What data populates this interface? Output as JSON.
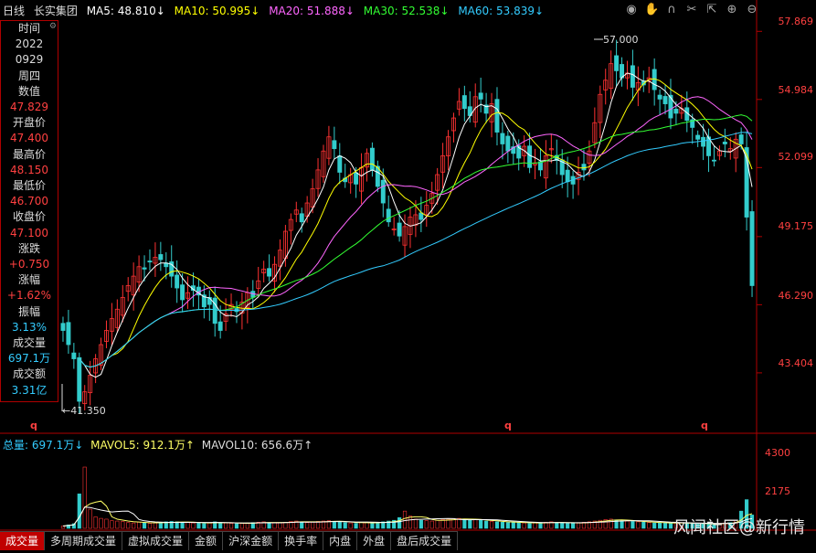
{
  "header": {
    "period": "日线",
    "stock": "长实集团",
    "ma5": "MA5: 48.810↓",
    "ma10": "MA10: 50.995↓",
    "ma20": "MA20: 51.888↓",
    "ma30": "MA30: 52.538↓",
    "ma60": "MA60: 53.839↓"
  },
  "toolbar_icons": [
    "eye-icon",
    "hand-icon",
    "magnet-icon",
    "scissors-icon",
    "cursor-icon",
    "zoom-in-icon",
    "zoom-out-icon"
  ],
  "info": {
    "time_label": "时间",
    "year": "2022",
    "date": "0929",
    "weekday": "周四",
    "value_label": "数值",
    "value": "47.829",
    "open_label": "开盘价",
    "open": "47.400",
    "high_label": "最高价",
    "high": "48.150",
    "low_label": "最低价",
    "low": "46.700",
    "close_label": "收盘价",
    "close": "47.100",
    "change_label": "涨跌",
    "change": "+0.750",
    "pct_label": "涨幅",
    "pct": "+1.62%",
    "amp_label": "振幅",
    "amp": "3.13%",
    "vol_label": "成交量",
    "vol": "697.1万",
    "amt_label": "成交额",
    "amt": "3.31亿"
  },
  "price_axis": [
    "57.869",
    "54.984",
    "52.099",
    "49.175",
    "46.290",
    "43.404"
  ],
  "annotations": {
    "high": "57.000",
    "low": "←41.350"
  },
  "q_marker": "q",
  "volume_header": {
    "total": "总量: 697.1万↓",
    "mavol5": "MAVOL5: 912.1万↑",
    "mavol10": "MAVOL10: 656.6万↑"
  },
  "volume_axis": [
    "4300",
    "2175"
  ],
  "tabs": [
    "成交量",
    "多周期成交量",
    "虚拟成交量",
    "金额",
    "沪深金额",
    "换手率",
    "内盘",
    "外盘",
    "盘后成交量"
  ],
  "active_tab": "成交量",
  "watermark": "风闻社区@新行情",
  "colors": {
    "up": "#ff3232",
    "down": "#33cccc",
    "ma5": "#ffffff",
    "ma10": "#ffff00",
    "ma20": "#ff66ff",
    "ma30": "#33ff33",
    "ma60": "#33ccff",
    "axis": "#b00000"
  },
  "chart_data": {
    "type": "candlestick",
    "y_range": [
      41.0,
      58.5
    ],
    "close_series": [
      45.2,
      44.6,
      44.0,
      42.2,
      42.6,
      43.3,
      44.0,
      44.6,
      45.2,
      45.7,
      46.1,
      46.6,
      47.1,
      47.5,
      47.9,
      47.8,
      48.1,
      48.3,
      48.2,
      47.9,
      47.5,
      47.0,
      46.5,
      46.8,
      46.9,
      46.7,
      46.2,
      46.3,
      45.5,
      45.2,
      45.9,
      46.3,
      46.0,
      46.4,
      46.8,
      46.6,
      47.3,
      47.8,
      47.5,
      48.0,
      48.6,
      49.4,
      49.9,
      50.3,
      49.8,
      50.6,
      51.2,
      52.0,
      52.8,
      53.4,
      52.9,
      51.9,
      51.5,
      51.8,
      51.4,
      52.1,
      52.7,
      52.0,
      51.3,
      50.6,
      49.8,
      49.5,
      49.2,
      49.6,
      50.0,
      50.1,
      49.9,
      50.5,
      51.0,
      51.8,
      52.6,
      53.4,
      54.2,
      54.9,
      54.6,
      54.3,
      55.1,
      55.0,
      54.4,
      54.8,
      53.6,
      53.1,
      52.8,
      52.7,
      52.5,
      53.0,
      52.1,
      52.3,
      52.0,
      52.6,
      52.9,
      52.4,
      51.8,
      51.5,
      51.4,
      51.9,
      52.0,
      52.8,
      54.0,
      55.2,
      55.8,
      56.5,
      56.2,
      55.9,
      56.1,
      55.5,
      55.7,
      55.6,
      55.9,
      55.4,
      55.0,
      54.8,
      54.2,
      54.4,
      54.6,
      54.1,
      53.8,
      53.3,
      53.0,
      52.6,
      52.4,
      52.8,
      53.1,
      52.9,
      53.3,
      53.1,
      50.0,
      47.1
    ],
    "volume_series": [
      120,
      180,
      240,
      1800,
      3200,
      1000,
      600,
      520,
      480,
      400,
      380,
      360,
      300,
      280,
      320,
      300,
      260,
      280,
      300,
      340,
      360,
      340,
      320,
      300,
      280,
      300,
      260,
      280,
      340,
      300,
      280,
      260,
      240,
      260,
      280,
      300,
      320,
      340,
      300,
      280,
      300,
      320,
      360,
      380,
      340,
      300,
      320,
      360,
      380,
      400,
      360,
      340,
      300,
      280,
      260,
      300,
      320,
      280,
      300,
      340,
      380,
      420,
      560,
      900,
      640,
      480,
      420,
      400,
      380,
      420,
      460,
      480,
      500,
      520,
      480,
      440,
      460,
      420,
      380,
      360,
      340,
      320,
      300,
      320,
      300,
      280,
      260,
      280,
      300,
      320,
      340,
      300,
      280,
      260,
      280,
      300,
      320,
      340,
      380,
      420,
      460,
      480,
      440,
      400,
      380,
      360,
      340,
      320,
      300,
      280,
      300,
      280,
      260,
      280,
      300,
      260,
      240,
      220,
      260,
      240,
      220,
      260,
      280,
      300,
      420,
      900,
      1500,
      697
    ]
  }
}
